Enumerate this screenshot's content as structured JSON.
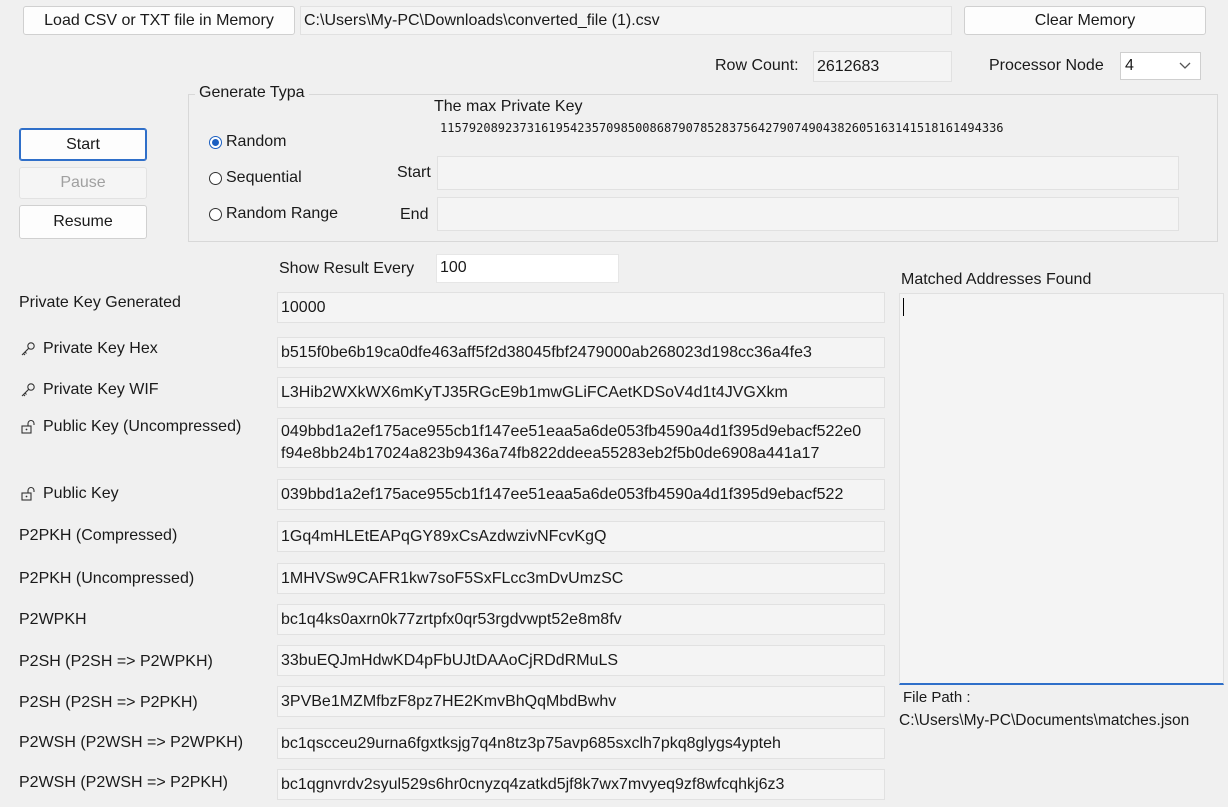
{
  "top": {
    "load_button": "Load CSV or TXT file in Memory",
    "file_path": "C:\\Users\\My-PC\\Downloads\\converted_file (1).csv",
    "clear_button": "Clear Memory",
    "row_count_label": "Row Count:",
    "row_count_value": "2612683",
    "processor_label": "Processor Node",
    "processor_value": "4"
  },
  "controls": {
    "start": "Start",
    "pause": "Pause",
    "resume": "Resume"
  },
  "generate": {
    "title": "Generate Typa",
    "max_key_label": "The max Private Key",
    "max_key_value": "115792089237316195423570985008687907852837564279074904382605163141518161494336",
    "options": [
      "Random",
      "Sequential",
      "Random Range"
    ],
    "selected": "Random",
    "start_label": "Start",
    "end_label": "End",
    "start_value": "",
    "end_value": ""
  },
  "show_result": {
    "label": "Show Result Every",
    "value": "100"
  },
  "results": {
    "private_key_generated_label": "Private Key Generated",
    "private_key_generated_value": "10000",
    "private_key_hex_label": "Private Key Hex",
    "private_key_hex_value": "b515f0be6b19ca0dfe463aff5f2d38045fbf2479000ab268023d198cc36a4fe3",
    "private_key_wif_label": "Private Key WIF",
    "private_key_wif_value": "L3Hib2WXkWX6mKyTJ35RGcE9b1mwGLiFCAetKDSoV4d1t4JVGXkm",
    "public_key_uncompressed_label": "Public Key (Uncompressed)",
    "public_key_uncompressed_value": "049bbd1a2ef175ace955cb1f147ee51eaa5a6de053fb4590a4d1f395d9ebacf522e0f94e8bb24b17024a823b9436a74fb822ddeea55283eb2f5b0de6908a441a17",
    "public_key_uncompressed_line1": "049bbd1a2ef175ace955cb1f147ee51eaa5a6de053fb4590a4d1f395d9ebacf522e0",
    "public_key_uncompressed_line2": "f94e8bb24b17024a823b9436a74fb822ddeea55283eb2f5b0de6908a441a17",
    "public_key_label": "Public Key",
    "public_key_value": "039bbd1a2ef175ace955cb1f147ee51eaa5a6de053fb4590a4d1f395d9ebacf522",
    "p2pkh_compressed_label": "P2PKH (Compressed)",
    "p2pkh_compressed_value": "1Gq4mHLEtEAPqGY89xCsAzdwzivNFcvKgQ",
    "p2pkh_uncompressed_label": "P2PKH (Uncompressed)",
    "p2pkh_uncompressed_value": "1MHVSw9CAFR1kw7soF5SxFLcc3mDvUmzSC",
    "p2wpkh_label": "P2WPKH",
    "p2wpkh_value": "bc1q4ks0axrn0k77zrtpfx0qr53rgdvwpt52e8m8fv",
    "p2sh_p2wpkh_label": "P2SH (P2SH => P2WPKH)",
    "p2sh_p2wpkh_value": "33buEQJmHdwKD4pFbUJtDAAoCjRDdRMuLS",
    "p2sh_p2pkh_label": "P2SH (P2SH => P2PKH)",
    "p2sh_p2pkh_value": "3PVBe1MZMfbzF8pz7HE2KmvBhQqMbdBwhv",
    "p2wsh_p2wpkh_label": "P2WSH (P2WSH => P2WPKH)",
    "p2wsh_p2wpkh_value": "bc1qscceu29urna6fgxtksjg7q4n8tz3p75avp685sxclh7pkq8glygs4ypteh",
    "p2wsh_p2pkh_label": "P2WSH (P2WSH => P2PKH)",
    "p2wsh_p2pkh_value": "bc1qgnvrdv2syul529s6hr0cnyzq4zatkd5jf8k7wx7mvyeq9zf8wfcqhkj6z3"
  },
  "matched": {
    "label": "Matched Addresses Found",
    "content": "",
    "file_path_label": "File Path :",
    "file_path_value": "C:\\Users\\My-PC\\Documents\\matches.json"
  },
  "icons": {
    "key": "key-icon",
    "lock": "unlock-icon"
  },
  "colors": {
    "accent": "#2f6fc9",
    "radio": "#1b5fc1"
  }
}
